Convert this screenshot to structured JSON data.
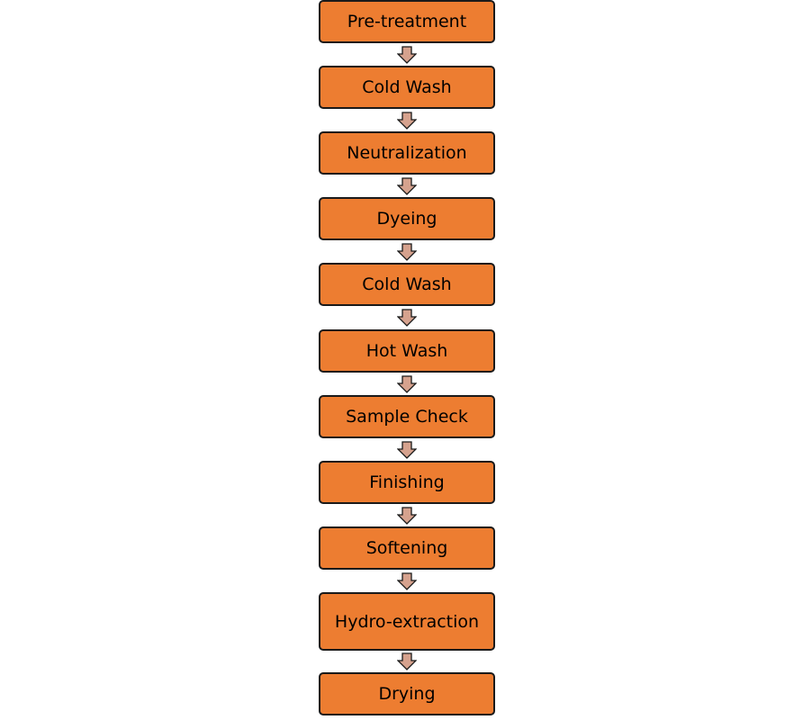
{
  "diagram": {
    "type": "vertical-flowchart",
    "box_color": "#ed7d31",
    "arrow_color": "#d6a28e",
    "steps": [
      {
        "label": "Pre-treatment"
      },
      {
        "label": "Cold Wash"
      },
      {
        "label": "Neutralization"
      },
      {
        "label": "Dyeing"
      },
      {
        "label": "Cold Wash"
      },
      {
        "label": "Hot Wash"
      },
      {
        "label": "Sample Check"
      },
      {
        "label": "Finishing"
      },
      {
        "label": "Softening"
      },
      {
        "label": "Hydro-extraction"
      },
      {
        "label": "Drying"
      }
    ]
  }
}
